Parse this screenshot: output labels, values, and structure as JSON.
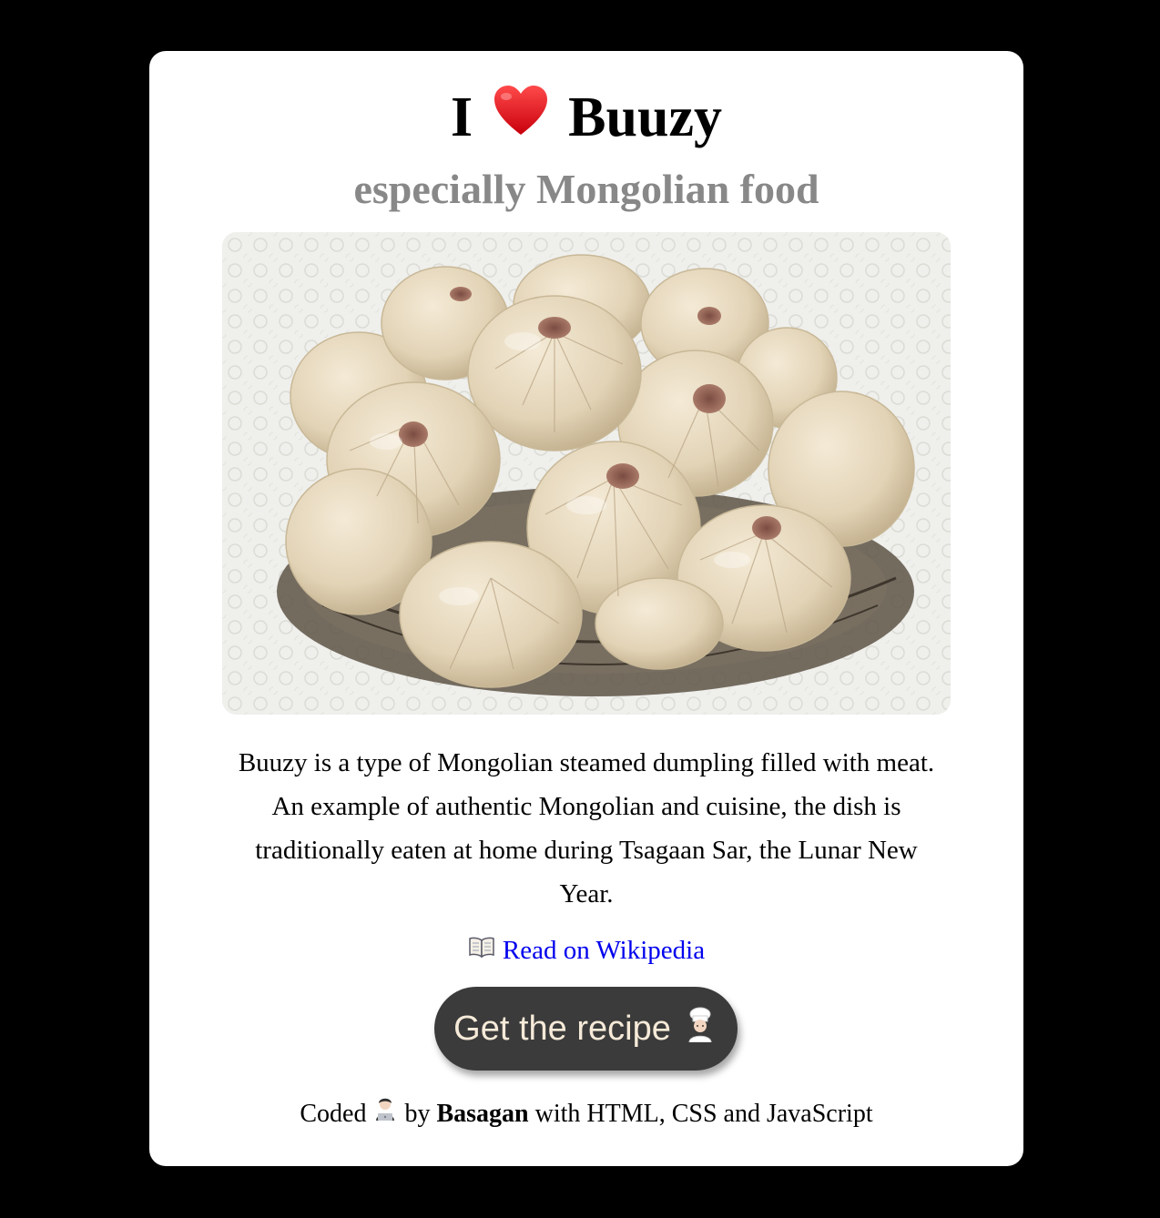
{
  "header": {
    "title_prefix": "I",
    "title_suffix": "Buuzy",
    "subtitle": "especially Mongolian food"
  },
  "icons": {
    "title_icon": "red-heart-icon",
    "wiki_icon": "open-book-icon",
    "button_icon": "cook-icon",
    "credits_icon": "technologist-icon"
  },
  "description": "Buuzy is a type of Mongolian steamed dumpling filled with meat. An example of authentic Mongolian and cuisine, the dish is traditionally eaten at home during Tsagaan Sar, the Lunar New Year.",
  "wiki": {
    "label": "Read on Wikipedia"
  },
  "recipe_button": {
    "label": "Get the recipe"
  },
  "credits": {
    "prefix": "Coded",
    "by": "by",
    "author": "Basagan",
    "suffix": "with HTML, CSS and JavaScript"
  },
  "colors": {
    "page_background": "#000000",
    "card_background": "#ffffff",
    "subtitle": "#888888",
    "link": "#0000ee",
    "button_background": "#3b3b3b",
    "button_text": "#f6ead8"
  }
}
